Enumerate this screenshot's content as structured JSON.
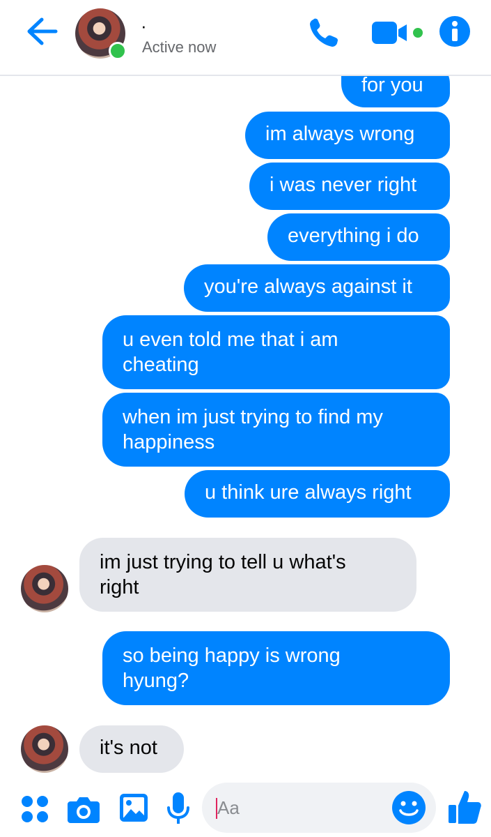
{
  "header": {
    "contact_name": "·",
    "status": "Active now"
  },
  "messages": [
    {
      "side": "out",
      "text": "for you"
    },
    {
      "side": "out",
      "text": "im always wrong"
    },
    {
      "side": "out",
      "text": "i was never right"
    },
    {
      "side": "out",
      "text": "everything i do"
    },
    {
      "side": "out",
      "text": "you're always against it"
    },
    {
      "side": "out",
      "lines": [
        "u even told me that i am",
        "cheating"
      ]
    },
    {
      "side": "out",
      "lines": [
        "when im just trying to find my",
        "happiness"
      ]
    },
    {
      "side": "out",
      "text": "u think ure always right"
    },
    {
      "side": "in",
      "lines": [
        "im just trying to tell u what's",
        "right"
      ]
    },
    {
      "side": "out",
      "lines": [
        "so being happy is wrong",
        "hyung?"
      ]
    },
    {
      "side": "in",
      "text": "it's not"
    }
  ],
  "composer": {
    "placeholder": "Aa"
  },
  "icons": {
    "back": "arrow-left-icon",
    "call": "phone-icon",
    "video": "video-camera-icon",
    "info": "info-icon",
    "menu": "four-dots-icon",
    "camera": "camera-icon",
    "gallery": "image-icon",
    "mic": "microphone-icon",
    "emoji": "smiley-icon",
    "like": "thumbs-up-icon"
  },
  "colors": {
    "accent": "#0084ff",
    "incoming_bubble": "#e4e6eb",
    "online": "#31c24d"
  }
}
